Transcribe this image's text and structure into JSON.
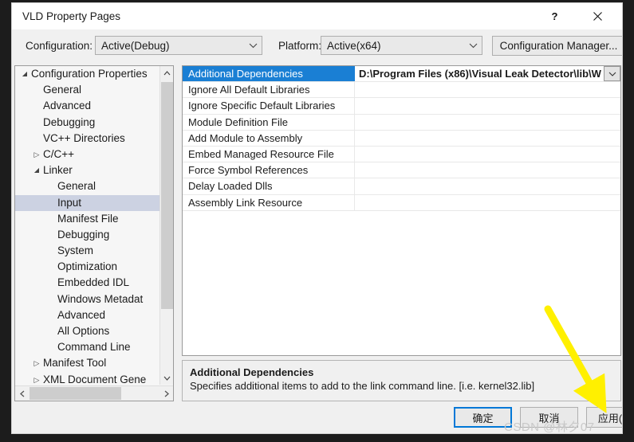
{
  "window": {
    "title": "VLD Property Pages",
    "help_icon": "question-mark-icon",
    "close_icon": "close-x-icon"
  },
  "toolbar": {
    "configuration_label": "Configuration:",
    "configuration_value": "Active(Debug)",
    "platform_label": "Platform:",
    "platform_value": "Active(x64)",
    "configuration_manager_label": "Configuration Manager...",
    "chevron_icon": "chevron-down-icon"
  },
  "tree": {
    "items": [
      {
        "label": "Configuration Properties",
        "level": 0,
        "glyph": "expanded-triangle-icon",
        "selected": false
      },
      {
        "label": "General",
        "level": 1,
        "glyph": "",
        "selected": false
      },
      {
        "label": "Advanced",
        "level": 1,
        "glyph": "",
        "selected": false
      },
      {
        "label": "Debugging",
        "level": 1,
        "glyph": "",
        "selected": false
      },
      {
        "label": "VC++ Directories",
        "level": 1,
        "glyph": "",
        "selected": false
      },
      {
        "label": "C/C++",
        "level": 1,
        "glyph": "collapsed-triangle-icon",
        "selected": false
      },
      {
        "label": "Linker",
        "level": 1,
        "glyph": "expanded-triangle-icon",
        "selected": false
      },
      {
        "label": "General",
        "level": 2,
        "glyph": "",
        "selected": false
      },
      {
        "label": "Input",
        "level": 2,
        "glyph": "",
        "selected": true
      },
      {
        "label": "Manifest File",
        "level": 2,
        "glyph": "",
        "selected": false
      },
      {
        "label": "Debugging",
        "level": 2,
        "glyph": "",
        "selected": false
      },
      {
        "label": "System",
        "level": 2,
        "glyph": "",
        "selected": false
      },
      {
        "label": "Optimization",
        "level": 2,
        "glyph": "",
        "selected": false
      },
      {
        "label": "Embedded IDL",
        "level": 2,
        "glyph": "",
        "selected": false
      },
      {
        "label": "Windows Metadat",
        "level": 2,
        "glyph": "",
        "selected": false
      },
      {
        "label": "Advanced",
        "level": 2,
        "glyph": "",
        "selected": false
      },
      {
        "label": "All Options",
        "level": 2,
        "glyph": "",
        "selected": false
      },
      {
        "label": "Command Line",
        "level": 2,
        "glyph": "",
        "selected": false
      },
      {
        "label": "Manifest Tool",
        "level": 1,
        "glyph": "collapsed-triangle-icon",
        "selected": false
      },
      {
        "label": "XML Document Gene",
        "level": 1,
        "glyph": "collapsed-triangle-icon",
        "selected": false
      }
    ],
    "scroll_up_icon": "chevron-up-icon",
    "scroll_down_icon": "chevron-down-icon",
    "scroll_left_icon": "chevron-left-icon",
    "scroll_right_icon": "chevron-right-icon"
  },
  "grid": {
    "rows": [
      {
        "name": "Additional Dependencies",
        "value": "D:\\Program Files (x86)\\Visual Leak Detector\\lib\\W",
        "selected": true
      },
      {
        "name": "Ignore All Default Libraries",
        "value": "",
        "selected": false
      },
      {
        "name": "Ignore Specific Default Libraries",
        "value": "",
        "selected": false
      },
      {
        "name": "Module Definition File",
        "value": "",
        "selected": false
      },
      {
        "name": "Add Module to Assembly",
        "value": "",
        "selected": false
      },
      {
        "name": "Embed Managed Resource File",
        "value": "",
        "selected": false
      },
      {
        "name": "Force Symbol References",
        "value": "",
        "selected": false
      },
      {
        "name": "Delay Loaded Dlls",
        "value": "",
        "selected": false
      },
      {
        "name": "Assembly Link Resource",
        "value": "",
        "selected": false
      }
    ],
    "value_dropdown_icon": "chevron-down-icon"
  },
  "description": {
    "title": "Additional Dependencies",
    "text": "Specifies additional items to add to the link command line. [i.e. kernel32.lib]"
  },
  "footer": {
    "ok_label": "确定",
    "cancel_label": "取消",
    "apply_label": "应用(A)"
  },
  "annotation": {
    "arrow_color": "#FFF000",
    "watermark": "CSDN @林夕07"
  },
  "colors": {
    "selection_blue": "#1A7FD4",
    "tree_selection": "#CCD2E2",
    "focus_border": "#0078D7",
    "dialog_bg": "#F0F0F0"
  }
}
